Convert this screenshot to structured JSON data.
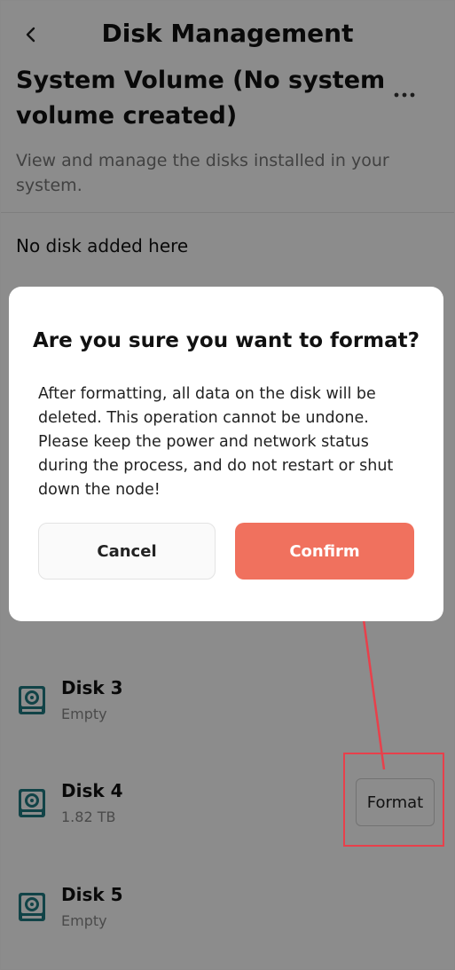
{
  "header": {
    "title": "Disk Management",
    "back_icon": "chevron-left-icon",
    "more_icon": "more-horizontal-icon"
  },
  "volume": {
    "title": "System Volume (No system volume created)",
    "description": "View and manage the disks installed in your system.",
    "empty_text": "No disk added here"
  },
  "disks": [
    {
      "name": "Disk 3",
      "detail": "Empty"
    },
    {
      "name": "Disk 4",
      "detail": "1.82 TB",
      "action_label": "Format"
    },
    {
      "name": "Disk 5",
      "detail": "Empty"
    }
  ],
  "dialog": {
    "title": "Are you sure you want to format?",
    "message": "After formatting, all data on the disk will be deleted. This operation cannot be undone. Please keep the power and network status during the process, and do not restart or shut down the node!",
    "cancel_label": "Cancel",
    "confirm_label": "Confirm"
  },
  "colors": {
    "confirm": "#f0715e",
    "highlight": "#e8404b",
    "disk_icon": "#1f7a82"
  }
}
